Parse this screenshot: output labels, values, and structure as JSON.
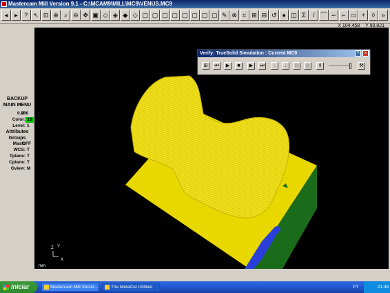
{
  "window": {
    "title": "Mastercam Mill Version 9.1 - C:\\MCAM9\\MILL\\MC9\\VENUS.MC9"
  },
  "toolbar": {
    "buttons": [
      {
        "icon": "arrow-left-icon",
        "glyph": "◂"
      },
      {
        "icon": "arrow-right-icon",
        "glyph": "▸"
      },
      {
        "icon": "help-icon",
        "glyph": "?"
      },
      {
        "icon": "pointer-icon",
        "glyph": "↖"
      },
      {
        "icon": "select-icon",
        "glyph": "⊡"
      },
      {
        "icon": "zoom-in-icon",
        "glyph": "⊕"
      },
      {
        "icon": "zoom-window-icon",
        "glyph": "⌕"
      },
      {
        "icon": "zoom-out-icon",
        "glyph": "⊖"
      },
      {
        "icon": "pan-icon",
        "glyph": "✥"
      },
      {
        "icon": "fit-icon",
        "glyph": "▣"
      },
      {
        "icon": "view-iso-icon",
        "glyph": "◇"
      },
      {
        "icon": "view-top-icon",
        "glyph": "◈"
      },
      {
        "icon": "view-front-icon",
        "glyph": "◆"
      },
      {
        "icon": "view-side-icon",
        "glyph": "◇"
      },
      {
        "icon": "cube-icon",
        "glyph": "▢"
      },
      {
        "icon": "cube2-icon",
        "glyph": "▢"
      },
      {
        "icon": "cube3-icon",
        "glyph": "▢"
      },
      {
        "icon": "cube4-icon",
        "glyph": "▢"
      },
      {
        "icon": "cube5-icon",
        "glyph": "▢"
      },
      {
        "icon": "cube6-icon",
        "glyph": "▢"
      },
      {
        "icon": "cube7-icon",
        "glyph": "▢"
      },
      {
        "icon": "cube8-icon",
        "glyph": "▢"
      },
      {
        "icon": "brush-icon",
        "glyph": "✎"
      },
      {
        "icon": "delete-icon",
        "glyph": "⊗"
      },
      {
        "icon": "toolpath-icon",
        "glyph": "⌗"
      },
      {
        "icon": "backplot-icon",
        "glyph": "⊞"
      },
      {
        "icon": "verify-icon",
        "glyph": "⊟"
      },
      {
        "icon": "undo-icon",
        "glyph": "↺"
      },
      {
        "icon": "sphere-icon",
        "glyph": "●"
      },
      {
        "icon": "surface-icon",
        "glyph": "◫"
      },
      {
        "icon": "sigma-icon",
        "glyph": "Σ"
      },
      {
        "icon": "line-icon",
        "glyph": "/"
      },
      {
        "icon": "arc-icon",
        "glyph": "⌒"
      },
      {
        "icon": "curve-icon",
        "glyph": "∽"
      },
      {
        "icon": "fillet-icon",
        "glyph": "⌐"
      },
      {
        "icon": "rectangle-icon",
        "glyph": "▭"
      },
      {
        "icon": "cross-icon",
        "glyph": "+"
      },
      {
        "icon": "diamond-icon",
        "glyph": "◊"
      },
      {
        "icon": "more-icon",
        "glyph": "»"
      }
    ]
  },
  "coords": {
    "x": "X 104.458",
    "y": "Y 90.821"
  },
  "menu": {
    "backup": "BACKUP",
    "main": "MAIN MENU"
  },
  "status": {
    "z": {
      "label": "Z:",
      "value": "0.000"
    },
    "color": {
      "label": "Color:",
      "value": "10",
      "swatch": "#00c000"
    },
    "level": {
      "label": "Level:",
      "value": "1"
    },
    "attributes": "Attributes",
    "groups": "Groups",
    "mask": {
      "label": "Mask:",
      "value": "OFF"
    },
    "wcs": {
      "label": "WCS:",
      "value": "T"
    },
    "tplane": {
      "label": "Tplane:",
      "value": "T"
    },
    "cplane": {
      "label": "Cplane:",
      "value": "T"
    },
    "gview": {
      "label": "Gview:",
      "value": "M"
    }
  },
  "axes": {
    "z": "Z",
    "y": "Y",
    "x": "X",
    "scale": "mm"
  },
  "verify": {
    "title": "Verify: TrueSolid Simulation : Current MC9",
    "help": "?",
    "close": "×"
  },
  "taskbar": {
    "start": "Iniciar",
    "tasks": [
      "Mastercam Mill Versio...",
      "The MetaCut Utilities"
    ],
    "lang": "PT",
    "clock": "21:49"
  },
  "colors": {
    "part": "#f2e01a",
    "stock": "#e8d800",
    "stock_side": "#1a6b1a",
    "tool": "#2a3fd9"
  }
}
